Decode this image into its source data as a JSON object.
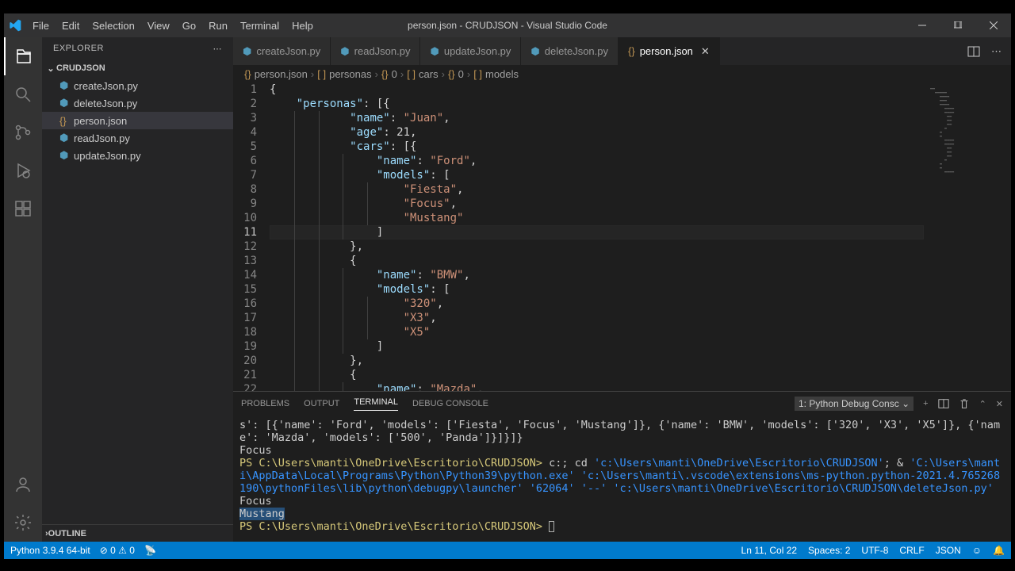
{
  "title": "person.json - CRUDJSON - Visual Studio Code",
  "menu": [
    "File",
    "Edit",
    "Selection",
    "View",
    "Go",
    "Run",
    "Terminal",
    "Help"
  ],
  "sidebar": {
    "header": "EXPLORER",
    "project": "CRUDJSON",
    "files": [
      {
        "name": "createJson.py",
        "selected": false,
        "iconColor": "#519aba"
      },
      {
        "name": "deleteJson.py",
        "selected": false,
        "iconColor": "#519aba"
      },
      {
        "name": "person.json",
        "selected": true,
        "iconColor": "#c09553"
      },
      {
        "name": "readJson.py",
        "selected": false,
        "iconColor": "#519aba"
      },
      {
        "name": "updateJson.py",
        "selected": false,
        "iconColor": "#519aba"
      }
    ],
    "outline": "OUTLINE"
  },
  "tabs": [
    {
      "name": "createJson.py",
      "active": false,
      "iconColor": "#519aba"
    },
    {
      "name": "readJson.py",
      "active": false,
      "iconColor": "#519aba"
    },
    {
      "name": "updateJson.py",
      "active": false,
      "iconColor": "#519aba"
    },
    {
      "name": "deleteJson.py",
      "active": false,
      "iconColor": "#519aba"
    },
    {
      "name": "person.json",
      "active": true,
      "iconColor": "#c09553"
    }
  ],
  "breadcrumbs": [
    "person.json",
    "personas",
    "0",
    "cars",
    "0",
    "models"
  ],
  "bc_icons": [
    "{}",
    "[ ]",
    "{}",
    "[ ]",
    "{}",
    "[ ]"
  ],
  "code_lines": [
    "{",
    "    \"personas\": [{",
    "            \"name\": \"Juan\",",
    "            \"age\": 21,",
    "            \"cars\": [{",
    "                \"name\": \"Ford\",",
    "                \"models\": [",
    "                    \"Fiesta\",",
    "                    \"Focus\",",
    "                    \"Mustang\"",
    "                ]",
    "            },",
    "            {",
    "                \"name\": \"BMW\",",
    "                \"models\": [",
    "                    \"320\",",
    "                    \"X3\",",
    "                    \"X5\"",
    "                ]",
    "            },",
    "            {",
    "                \"name\": \"Mazda\","
  ],
  "current_line": 11,
  "panel": {
    "tabs": [
      "PROBLEMS",
      "OUTPUT",
      "TERMINAL",
      "DEBUG CONSOLE"
    ],
    "active": 2,
    "select": "1: Python Debug Consc",
    "terminal_prefix": "s': [{'name': 'Ford', 'models': ['Fiesta', 'Focus', 'Mustang']}, {'name': 'BMW', 'models': ['320', 'X3', 'X5']}, {'name': 'Mazda', 'models': ['500', 'Panda']}]}]}",
    "terminal_lines": [
      "Focus",
      "PS C:\\Users\\manti\\OneDrive\\Escritorio\\CRUDJSON> c:; cd 'c:\\Users\\manti\\OneDrive\\Escritorio\\CRUDJSON'; & 'C:\\Users\\manti\\AppData\\Local\\Programs\\Python\\Python39\\python.exe' 'c:\\Users\\manti\\.vscode\\extensions\\ms-python.python-2021.4.765268190\\pythonFiles\\lib\\python\\debugpy\\launcher' '62064' '--' 'c:\\Users\\manti\\OneDrive\\Escritorio\\CRUDJSON\\deleteJson.py'",
      "Focus",
      "Mustang",
      "PS C:\\Users\\manti\\OneDrive\\Escritorio\\CRUDJSON> "
    ]
  },
  "status": {
    "python": "Python 3.9.4 64-bit",
    "errors": "0",
    "warnings": "0",
    "pos": "Ln 11, Col 22",
    "spaces": "Spaces: 2",
    "encoding": "UTF-8",
    "eol": "CRLF",
    "lang": "JSON"
  }
}
